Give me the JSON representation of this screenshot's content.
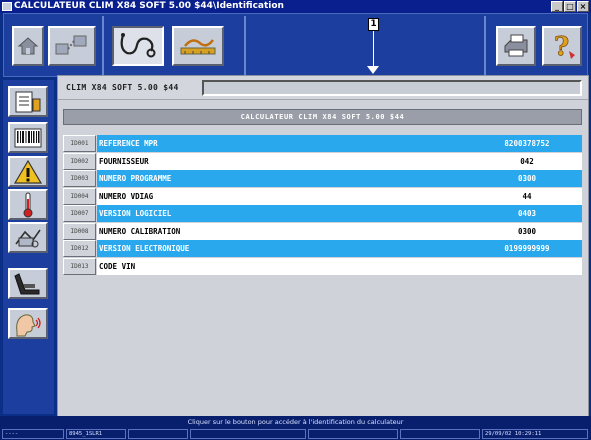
{
  "window": {
    "title": "CALCULATEUR CLIM X84 SOFT 5.00 $44\\Identification",
    "buttons": [
      "_",
      "□",
      "×"
    ]
  },
  "toolbar": {
    "callout_number": "1",
    "buttons": [
      "home-icon",
      "network-icon",
      "stethoscope-icon",
      "measurement-icon",
      "printer-icon",
      "help-icon"
    ]
  },
  "sidebar": {
    "buttons": [
      "document-icon",
      "barcode-icon",
      "warning-icon",
      "thermometer-icon",
      "actuator-icon",
      "seat-icon",
      "speaker-head-icon"
    ]
  },
  "vehicle": {
    "label": "CLIM X84 SOFT 5.00 $44",
    "field_value": ""
  },
  "ecu": {
    "header": "CALCULATEUR CLIM X84 SOFT 5.00 $44"
  },
  "identification": {
    "rows": [
      {
        "code": "ID001",
        "label": "REFERENCE MPR",
        "value": "8200378752",
        "highlight": true
      },
      {
        "code": "ID002",
        "label": "FOURNISSEUR",
        "value": "042",
        "highlight": false
      },
      {
        "code": "ID003",
        "label": "NUMERO PROGRAMME",
        "value": "0300",
        "highlight": true
      },
      {
        "code": "ID004",
        "label": "NUMERO VDIAG",
        "value": "44",
        "highlight": false
      },
      {
        "code": "ID007",
        "label": "VERSION LOGICIEL",
        "value": "0403",
        "highlight": true
      },
      {
        "code": "ID008",
        "label": "NUMERO CALIBRATION",
        "value": "0300",
        "highlight": false
      },
      {
        "code": "ID012",
        "label": "VERSION ELECTRONIQUE",
        "value": "0199999999",
        "highlight": true
      },
      {
        "code": "ID013",
        "label": "CODE VIN",
        "value": "",
        "highlight": false
      }
    ]
  },
  "status": {
    "message": "Cliquer sur le bouton pour accéder à l'identification du calculateur"
  },
  "taskbar": {
    "cells": [
      "----",
      "8945_1SLR1",
      "",
      "",
      "",
      "",
      "29/09/02  10:29:11"
    ]
  },
  "colors": {
    "highlight": "#29a8ee",
    "background": "#0b2f86",
    "panel": "#cfd2d8"
  }
}
